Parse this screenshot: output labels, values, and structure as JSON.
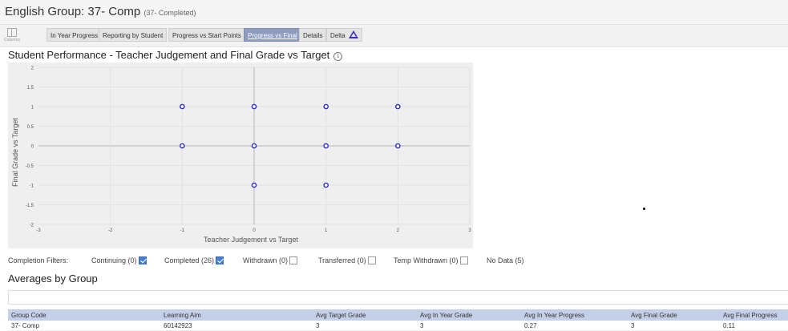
{
  "header": {
    "title": "English Group: 37- Comp",
    "subtitle": "(37- Completed)"
  },
  "toolbar": {
    "columns_label": "Columns",
    "tabs": [
      {
        "label": "In Year Progress"
      },
      {
        "label": "Reporting by Student"
      },
      {
        "label": "Progress vs Start Points"
      },
      {
        "label": "Progress vs Final"
      },
      {
        "label": "Details"
      },
      {
        "label": "Delta"
      }
    ],
    "active_tab": "Progress vs Final"
  },
  "performance": {
    "title": "Student Performance - Teacher Judgement and Final Grade vs Target"
  },
  "chart_data": {
    "type": "scatter",
    "xlabel": "Teacher Judgement vs Target",
    "ylabel": "Final Grade vs Target",
    "xlim": [
      -3,
      3
    ],
    "ylim": [
      -2,
      2
    ],
    "xticks": [
      "-3",
      "-2",
      "-1",
      "0",
      "1",
      "2",
      "3"
    ],
    "yticks": [
      "2",
      "1.5",
      "1",
      "0.5",
      "0",
      "-0.5",
      "-1",
      "-1.5",
      "-2"
    ],
    "grid": true,
    "marker_color": "#2b2bc8",
    "points": [
      {
        "x": -1,
        "y": 1
      },
      {
        "x": 0,
        "y": 1
      },
      {
        "x": 1,
        "y": 1
      },
      {
        "x": 2,
        "y": 1
      },
      {
        "x": -1,
        "y": 0
      },
      {
        "x": 0,
        "y": 0
      },
      {
        "x": 1,
        "y": 0
      },
      {
        "x": 2,
        "y": 0
      },
      {
        "x": 0,
        "y": -1
      },
      {
        "x": 1,
        "y": -1
      }
    ]
  },
  "filters": {
    "label": "Completion Filters:",
    "items": [
      {
        "label": "Continuing (0)",
        "checked": true
      },
      {
        "label": "Completed (26)",
        "checked": true
      },
      {
        "label": "Withdrawn (0)",
        "checked": false
      },
      {
        "label": "Transferred (0)",
        "checked": false
      },
      {
        "label": "Temp Withdrawn (0)",
        "checked": false
      },
      {
        "label": "No Data (5)"
      }
    ]
  },
  "averages": {
    "title": "Averages by Group",
    "columns": [
      "Group Code",
      "Learning Aim",
      "Avg Target Grade",
      "Avg In Year Grade",
      "Avg In Year Progress",
      "Avg Final Grade",
      "Avg Final Progress"
    ],
    "rows": [
      [
        "37- Comp",
        "60142923",
        "3",
        "3",
        "0.27",
        "3",
        "0.11"
      ]
    ]
  }
}
